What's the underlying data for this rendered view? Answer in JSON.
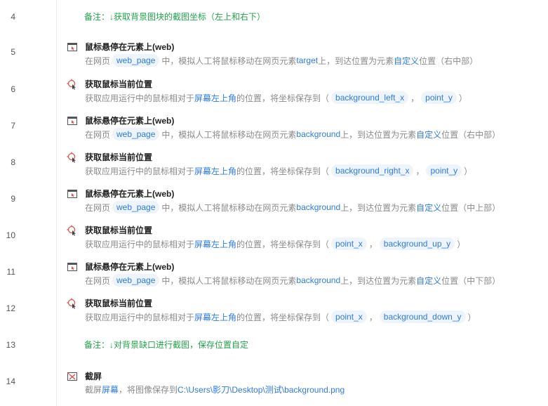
{
  "colors": {
    "note_green": "#22a34a",
    "link_blue": "#2d7be5",
    "chip_bg": "#eef4fc",
    "desc_gray": "#8a8a8a",
    "icon_red": "#d9534f"
  },
  "rows": [
    {
      "lineno": "4",
      "note": "备注：↓获取背景图块的截图坐标（左上和右下）"
    },
    {
      "lineno": "5",
      "icon": "browser-window-icon",
      "title": "鼠标悬停在元素上(web)",
      "d1": "在网页",
      "chip1": "web_page",
      "d2": "中，模拟人工将鼠标移动在网页元素",
      "target": "target",
      "d3": "上，到达位置为元素",
      "pos": "自定义",
      "d4": "位置（右中部）"
    },
    {
      "lineno": "6",
      "icon": "mouse-cursor-target-icon",
      "title": "获取鼠标当前位置",
      "d1": "获取应用运行中的鼠标相对于",
      "screen": "屏幕左上角",
      "d2": "的位置，将坐标保存到（",
      "chip1": "background_left_x",
      "sep": "，",
      "chip2": "point_y",
      "end": "）"
    },
    {
      "lineno": "7",
      "icon": "browser-window-icon",
      "title": "鼠标悬停在元素上(web)",
      "d1": "在网页",
      "chip1": "web_page",
      "d2": "中，模拟人工将鼠标移动在网页元素",
      "target": "background",
      "d3": "上，到达位置为元素",
      "pos": "自定义",
      "d4": "位置（右中部）"
    },
    {
      "lineno": "8",
      "icon": "mouse-cursor-target-icon",
      "title": "获取鼠标当前位置",
      "d1": "获取应用运行中的鼠标相对于",
      "screen": "屏幕左上角",
      "d2": "的位置，将坐标保存到（",
      "chip1": "background_right_x",
      "sep": "，",
      "chip2": "point_y",
      "end": "）"
    },
    {
      "lineno": "9",
      "icon": "browser-window-icon",
      "title": "鼠标悬停在元素上(web)",
      "d1": "在网页",
      "chip1": "web_page",
      "d2": "中，模拟人工将鼠标移动在网页元素",
      "target": "background",
      "d3": "上，到达位置为元素",
      "pos": "自定义",
      "d4": "位置（中上部）"
    },
    {
      "lineno": "10",
      "icon": "mouse-cursor-target-icon",
      "title": "获取鼠标当前位置",
      "d1": "获取应用运行中的鼠标相对于",
      "screen": "屏幕左上角",
      "d2": "的位置，将坐标保存到（",
      "chip1": "point_x",
      "sep": "，",
      "chip2": "background_up_y",
      "end": "）"
    },
    {
      "lineno": "11",
      "icon": "browser-window-icon",
      "title": "鼠标悬停在元素上(web)",
      "d1": "在网页",
      "chip1": "web_page",
      "d2": "中，模拟人工将鼠标移动在网页元素",
      "target": "background",
      "d3": "上，到达位置为元素",
      "pos": "自定义",
      "d4": "位置（中下部）"
    },
    {
      "lineno": "12",
      "icon": "mouse-cursor-target-icon",
      "title": "获取鼠标当前位置",
      "d1": "获取应用运行中的鼠标相对于",
      "screen": "屏幕左上角",
      "d2": "的位置，将坐标保存到（",
      "chip1": "point_x",
      "sep": "，",
      "chip2": "background_down_y",
      "end": "）"
    },
    {
      "lineno": "13",
      "note": "备注：↓对背景缺口进行截图，保存位置自定"
    },
    {
      "lineno": "14",
      "icon": "screenshot-icon",
      "title": "截屏",
      "d1": "截屏",
      "screen": "屏幕",
      "d2": "，将图像保存到",
      "path": "C:\\Users\\影刀\\Desktop\\测试\\background.png"
    }
  ]
}
